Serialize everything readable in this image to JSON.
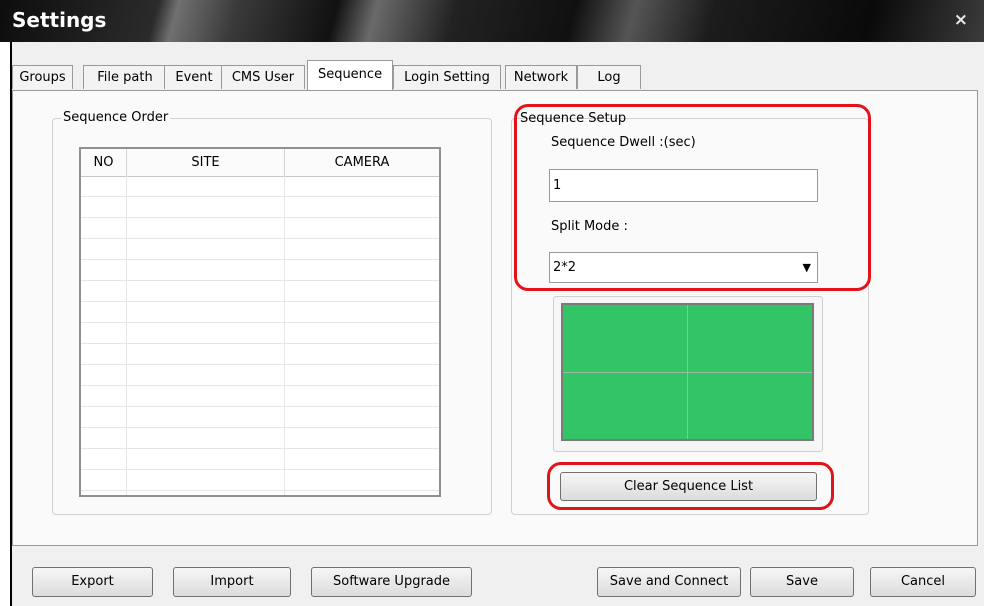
{
  "window": {
    "title": "Settings",
    "close_glyph": "×"
  },
  "tabs": [
    {
      "label": "Groups"
    },
    {
      "label": "File path"
    },
    {
      "label": "Event"
    },
    {
      "label": "CMS User"
    },
    {
      "label": "Sequence",
      "active": true
    },
    {
      "label": "Login Setting"
    },
    {
      "label": "Network"
    },
    {
      "label": "Log"
    }
  ],
  "sequence_order": {
    "group_label": "Sequence Order",
    "columns": [
      "NO",
      "SITE",
      "CAMERA"
    ],
    "rows": []
  },
  "sequence_setup": {
    "group_label": "Sequence Setup",
    "dwell_label": "Sequence Dwell :(sec)",
    "dwell_value": "1",
    "split_label": "Split Mode :",
    "split_value": "2*2",
    "split_dropdown_icon": "chevron-down-icon",
    "preview_grid": {
      "rows": 2,
      "cols": 2,
      "color": "#33c466"
    },
    "clear_button": "Clear Sequence List"
  },
  "footer": {
    "export": "Export",
    "import": "Import",
    "upgrade": "Software Upgrade",
    "save_connect": "Save and Connect",
    "save": "Save",
    "cancel": "Cancel"
  },
  "colors": {
    "highlight": "#e2141b",
    "preview_green": "#33c466"
  }
}
